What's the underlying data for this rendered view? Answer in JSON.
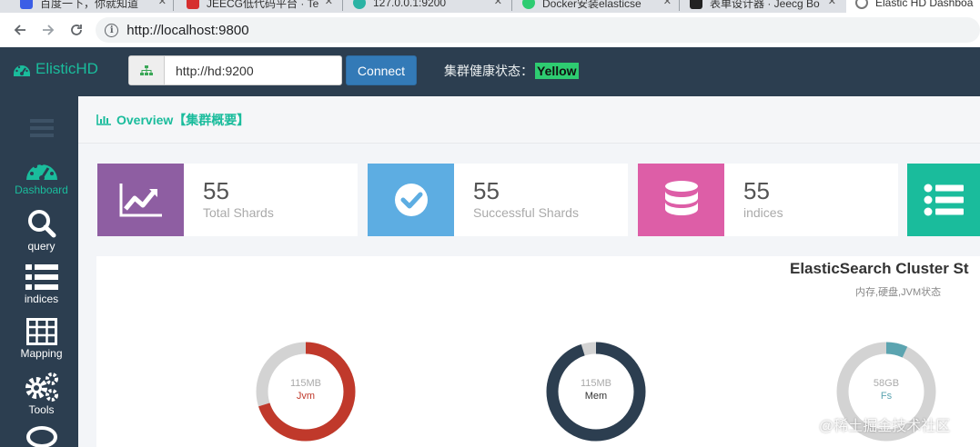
{
  "browser": {
    "tabs": [
      {
        "label": "百度一下，你就知道"
      },
      {
        "label": "JEECG低代码平台 · Te"
      },
      {
        "label": "127.0.0.1:9200"
      },
      {
        "label": "Docker安装elasticse"
      },
      {
        "label": "表单设计器 · Jeecg Bo"
      },
      {
        "label": "Elastic HD Dashboa"
      }
    ],
    "address": "http://localhost:9800"
  },
  "app": {
    "brand": "ElisticHD",
    "url_value": "http://hd:9200",
    "connect_label": "Connect",
    "health_label": "集群健康状态：",
    "health_value": "Yellow"
  },
  "sidebar": {
    "items": [
      {
        "label": "Dashboard"
      },
      {
        "label": "query"
      },
      {
        "label": "indices"
      },
      {
        "label": "Mapping"
      },
      {
        "label": "Tools"
      }
    ]
  },
  "page": {
    "title": "Overview【集群概要】"
  },
  "stats": [
    {
      "value": "55",
      "label": "Total Shards",
      "color": "#8e5ea2"
    },
    {
      "value": "55",
      "label": "Successful Shards",
      "color": "#5dade2"
    },
    {
      "value": "55",
      "label": "indices",
      "color": "#dd5ea7"
    },
    {
      "color": "#1abc9c"
    }
  ],
  "cluster": {
    "title": "ElasticSearch Cluster St",
    "subtitle": "内存,硬盘,JVM状态",
    "gauges": [
      {
        "value": "115MB",
        "label": "Jvm",
        "fraction": 0.7,
        "color": "#c0392b",
        "label_color": "#c0392b"
      },
      {
        "value": "115MB",
        "label": "Mem",
        "fraction": 0.95,
        "color": "#2c3e50",
        "label_color": "#333333"
      },
      {
        "value": "58GB",
        "label": "Fs",
        "fraction": 0.07,
        "color": "#5ba4b0",
        "label_color": "#5ba4b0"
      }
    ]
  },
  "watermark": "@稀土掘金技术社区",
  "colors": {
    "accent": "#1abc9c",
    "navy": "#2c3e50",
    "primary": "#337ab7",
    "health": "#2ecc71"
  }
}
